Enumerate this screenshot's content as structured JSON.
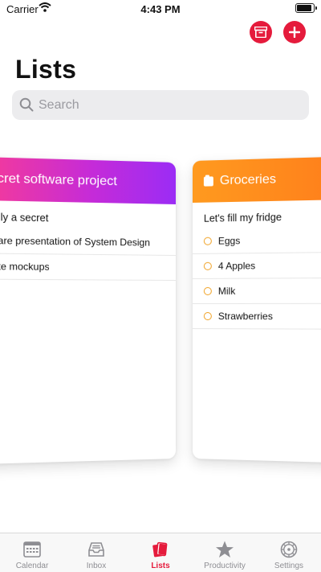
{
  "status_bar": {
    "carrier": "Carrier",
    "time": "4:43 PM"
  },
  "header": {
    "title": "Lists"
  },
  "search": {
    "placeholder": "Search"
  },
  "cards": [
    {
      "title": "Secret software project",
      "title_visible": "ecret software project",
      "description": "ally a secret",
      "items": [
        "pare presentation of System Design",
        "ate mockups"
      ],
      "gradient": [
        "#ff3e8c",
        "#9b2cf5"
      ]
    },
    {
      "title": "Groceries",
      "description": "Let's fill my fridge",
      "items": [
        "Eggs",
        "4 Apples",
        "Milk",
        "Strawberries"
      ],
      "accent": "#ff8c1a"
    }
  ],
  "tabbar": {
    "active": "Lists",
    "items": [
      {
        "label": "Calendar",
        "icon": "calendar-icon"
      },
      {
        "label": "Inbox",
        "icon": "inbox-icon"
      },
      {
        "label": "Lists",
        "icon": "lists-icon"
      },
      {
        "label": "Productivity",
        "icon": "star-icon"
      },
      {
        "label": "Settings",
        "icon": "gear-icon"
      }
    ]
  },
  "colors": {
    "accent": "#e51b3c",
    "search_bg": "#ececee"
  }
}
